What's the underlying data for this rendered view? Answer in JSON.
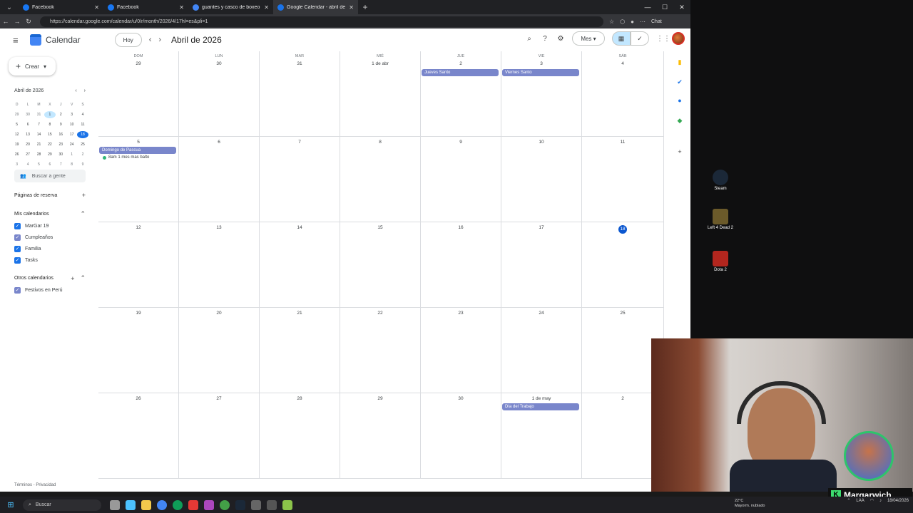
{
  "browser": {
    "tabs": [
      {
        "title": "Facebook",
        "color": "#1877f2",
        "active": false
      },
      {
        "title": "Facebook",
        "color": "#1877f2",
        "active": false
      },
      {
        "title": "guantes y casco de boxeo - Busca",
        "color": "#4285f4",
        "active": false
      },
      {
        "title": "Google Calendar - abril de 2026",
        "color": "#1a73e8",
        "active": true
      }
    ],
    "url": "https://calendar.google.com/calendar/u/0/r/month/2026/4/17hl=es&pli=1",
    "chat_label": "Chat"
  },
  "header": {
    "app_name": "Calendar",
    "today_label": "Hoy",
    "month_title": "Abril de 2026",
    "view_label": "Mes"
  },
  "sidebar": {
    "create_label": "Crear",
    "mini_title": "Abril de 2026",
    "mini_dow": [
      "D",
      "L",
      "M",
      "X",
      "J",
      "V",
      "S"
    ],
    "mini_weeks": [
      [
        "29",
        "30",
        "31",
        "1",
        "2",
        "3",
        "4"
      ],
      [
        "5",
        "6",
        "7",
        "8",
        "9",
        "10",
        "11"
      ],
      [
        "12",
        "13",
        "14",
        "15",
        "16",
        "17",
        "18"
      ],
      [
        "19",
        "20",
        "21",
        "22",
        "23",
        "24",
        "25"
      ],
      [
        "26",
        "27",
        "28",
        "29",
        "30",
        "1",
        "2"
      ],
      [
        "3",
        "4",
        "5",
        "6",
        "7",
        "8",
        "9"
      ]
    ],
    "search_people": "Buscar a gente",
    "booking_pages": "Páginas de reserva",
    "my_calendars": "Mis calendarios",
    "my_calendar_items": [
      {
        "label": "MarGar 19",
        "color": "#1a73e8"
      },
      {
        "label": "Cumpleaños",
        "color": "#7986cb"
      },
      {
        "label": "Familia",
        "color": "#1a73e8"
      },
      {
        "label": "Tasks",
        "color": "#1a73e8"
      }
    ],
    "other_calendars": "Otros calendarios",
    "other_calendar_items": [
      {
        "label": "Festivos en Perú",
        "color": "#7986cb"
      }
    ],
    "terms": "Términos - Privacidad"
  },
  "grid": {
    "dow": [
      "DOM",
      "LUN",
      "MAR",
      "MIÉ",
      "JUE",
      "VIE",
      "SÁB"
    ],
    "weeks": [
      [
        "29",
        "30",
        "31",
        "1 de abr",
        "2",
        "3",
        "4"
      ],
      [
        "5",
        "6",
        "7",
        "8",
        "9",
        "10",
        "11"
      ],
      [
        "12",
        "13",
        "14",
        "15",
        "16",
        "17",
        "18"
      ],
      [
        "19",
        "20",
        "21",
        "22",
        "23",
        "24",
        "25"
      ],
      [
        "26",
        "27",
        "28",
        "29",
        "30",
        "1 de may",
        "2"
      ]
    ],
    "today": "18",
    "events": [
      {
        "week": 0,
        "day": 4,
        "title": "Jueves Santo",
        "type": "allday"
      },
      {
        "week": 0,
        "day": 5,
        "title": "Viernes Santo",
        "type": "allday"
      },
      {
        "week": 1,
        "day": 0,
        "title": "Domingo de Pascua",
        "type": "allday"
      },
      {
        "week": 1,
        "day": 0,
        "title": "8am 1 mes mas balto",
        "type": "timed"
      },
      {
        "week": 4,
        "day": 5,
        "title": "Día del Trabajo",
        "type": "allday"
      }
    ],
    "event_color": "#7986cb"
  },
  "desktop": {
    "icons": [
      {
        "label": "Steam"
      },
      {
        "label": "Left 4 Dead 2"
      },
      {
        "label": "Dota 2"
      }
    ],
    "streamer_name": "Margarwich"
  },
  "taskbar": {
    "search_placeholder": "Buscar",
    "weather_temp": "22°C",
    "weather_desc": "Mayorm. nublado",
    "lang": "LAA",
    "date": "18/04/2026"
  }
}
